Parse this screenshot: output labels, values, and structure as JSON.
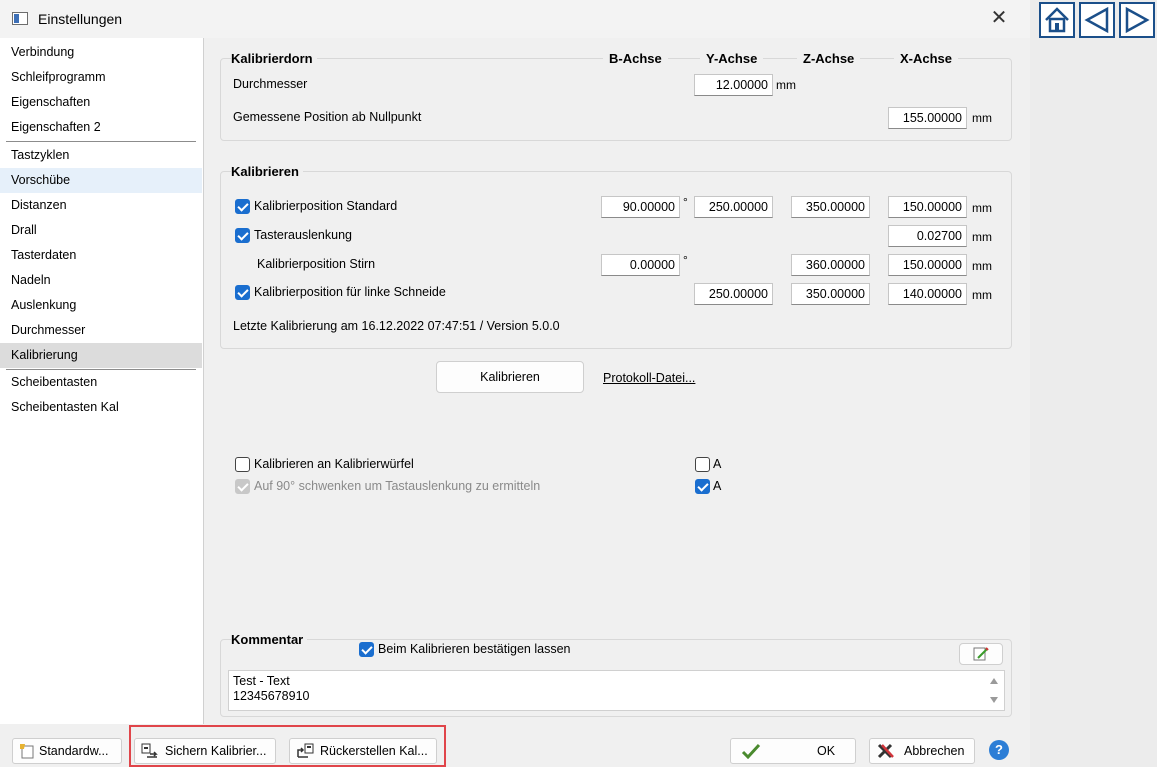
{
  "window": {
    "title": "Einstellungen"
  },
  "sidebar": {
    "items": [
      {
        "label": "Verbindung"
      },
      {
        "label": "Schleifprogramm"
      },
      {
        "label": "Eigenschaften"
      },
      {
        "label": "Eigenschaften 2"
      },
      {
        "label": "Tastzyklen"
      },
      {
        "label": "Vorschübe"
      },
      {
        "label": "Distanzen"
      },
      {
        "label": "Drall"
      },
      {
        "label": "Tasterdaten"
      },
      {
        "label": "Nadeln"
      },
      {
        "label": "Auslenkung"
      },
      {
        "label": "Durchmesser"
      },
      {
        "label": "Kalibrierung"
      },
      {
        "label": "Scheibentasten"
      },
      {
        "label": "Scheibentasten Kal"
      }
    ],
    "selected": "Kalibrierung",
    "hovered": "Vorschübe"
  },
  "kalibrierdorn": {
    "title": "Kalibrierdorn",
    "axes": [
      "B-Achse",
      "Y-Achse",
      "Z-Achse",
      "X-Achse"
    ],
    "durchmesser_label": "Durchmesser",
    "durchmesser_value": "12.00000",
    "durchmesser_unit": "mm",
    "position_label": "Gemessene Position ab Nullpunkt",
    "position_value": "155.00000",
    "position_unit": "mm"
  },
  "kalibrieren": {
    "title": "Kalibrieren",
    "rows": [
      {
        "label": "Kalibrierposition Standard",
        "checked": true,
        "b": "90.00000",
        "b_unit": "°",
        "y": "250.00000",
        "z": "350.00000",
        "x": "150.00000",
        "x_unit": "mm"
      },
      {
        "label": "Tasterauslenkung",
        "checked": true,
        "x": "0.02700",
        "x_unit": "mm"
      },
      {
        "label": "Kalibrierposition Stirn",
        "b": "0.00000",
        "b_unit": "°",
        "z": "360.00000",
        "x": "150.00000",
        "x_unit": "mm"
      },
      {
        "label": "Kalibrierposition für linke Schneide",
        "checked": true,
        "y": "250.00000",
        "z": "350.00000",
        "x": "140.00000",
        "x_unit": "mm"
      }
    ],
    "last_calibration": "Letzte Kalibrierung am 16.12.2022 07:47:51 / Version 5.0.0"
  },
  "actions": {
    "kalibrieren_button": "Kalibrieren",
    "protokoll_link": "Protokoll-Datei..."
  },
  "options": {
    "wuerfel_label": "Kalibrieren an Kalibrierwürfel",
    "wuerfel_checked": false,
    "wuerfel_axis": "A",
    "wuerfel_axis_checked": false,
    "schwenken_label": "Auf 90° schwenken um Tastauslenkung zu ermitteln",
    "schwenken_checked": true,
    "schwenken_axis": "A",
    "schwenken_axis_checked": true
  },
  "kommentar": {
    "title": "Kommentar",
    "confirm_label": "Beim Kalibrieren bestätigen lassen",
    "confirm_checked": true,
    "text_line1": "Test - Text",
    "text_line2": "12345678910"
  },
  "bottom": {
    "standard": "Standardw...",
    "sichern": "Sichern Kalibrier...",
    "rueckstellen": "Rückerstellen Kal...",
    "ok": "OK",
    "abbrechen": "Abbrechen",
    "help": "?"
  },
  "colors": {
    "accent": "#1a6ecf",
    "highlight_box": "#e0454a",
    "nav_border": "#1b4f8a"
  }
}
